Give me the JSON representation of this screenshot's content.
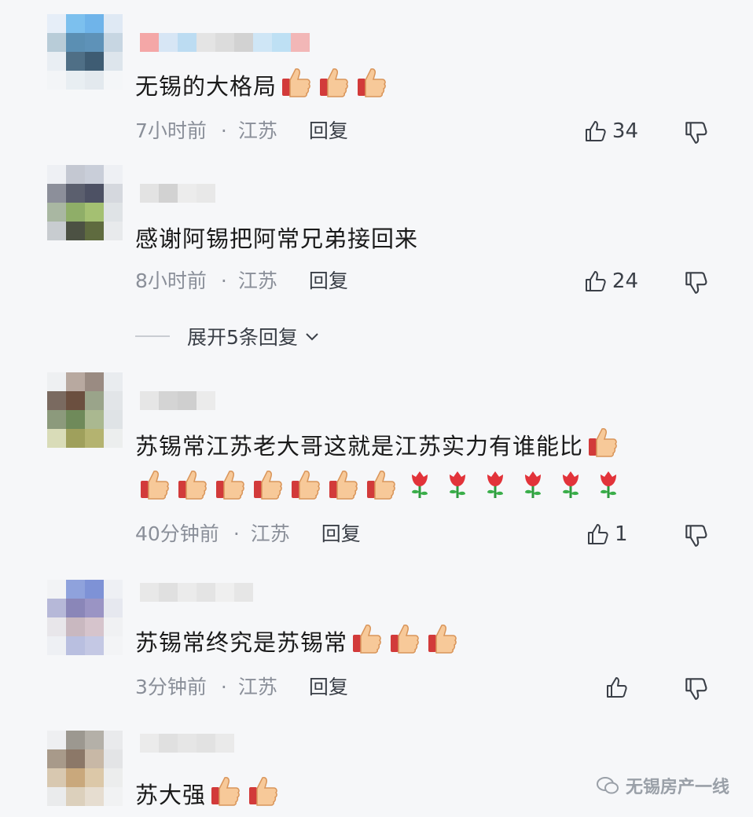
{
  "comments": [
    {
      "text": "无锡的大格局",
      "time": "7小时前",
      "location": "江苏",
      "reply_label": "回复",
      "likes": "34",
      "thumbs": 3,
      "avatar": [
        "#e6eef8",
        "#7cc0ee",
        "#6fb4ea",
        "#dfe9f4",
        "#b8ccd8",
        "#5b8fb3",
        "#5e92b8",
        "#c7d6e2",
        "#e9eef3",
        "#4f6f86",
        "#3e5c73",
        "#dde5ec",
        "#f3f5f7",
        "#e8eef2",
        "#e3e9ee",
        "#f4f6f8"
      ],
      "name_colors": [
        "#f4a7a7",
        "#d7e6f5",
        "#bcdcf2",
        "#e4e4e4",
        "#dcdcdc",
        "#d2d2d2",
        "#cfe6f6",
        "#bee0f4",
        "#f2b7b7"
      ]
    },
    {
      "text": "感谢阿锡把阿常兄弟接回来",
      "time": "8小时前",
      "location": "江苏",
      "reply_label": "回复",
      "likes": "24",
      "thumbs": 0,
      "avatar": [
        "#eef0f4",
        "#c4c8d2",
        "#c9ced9",
        "#eef0f4",
        "#8c8f9a",
        "#5b5f6e",
        "#4d5164",
        "#d5d8de",
        "#a9b7a2",
        "#8fae68",
        "#a4c072",
        "#dfe3e6",
        "#c8ccd0",
        "#4c5143",
        "#5f6b3f",
        "#e8eaec"
      ],
      "name_colors": [
        "#e3e3e3",
        "#d2d2d2",
        "#ececec",
        "#e8e8e8"
      ]
    },
    {
      "text": "苏锡常江苏老大哥这就是江苏实力有谁能比",
      "time": "40分钟前",
      "location": "江苏",
      "reply_label": "回复",
      "likes": "1",
      "thumbs": 8,
      "roses": 6,
      "avatar": [
        "#eef0f2",
        "#b8a9a0",
        "#9a8b82",
        "#e9ecef",
        "#7a6a60",
        "#6b4f3f",
        "#9aa48a",
        "#e2e5e8",
        "#8c9a7c",
        "#6f8a5a",
        "#aab890",
        "#dfe3e6",
        "#d9dcb8",
        "#9fa05c",
        "#b4b370",
        "#eceeee"
      ],
      "name_colors": [
        "#e6e6e6",
        "#d4d4d4",
        "#cfcfcf",
        "#ebebeb"
      ]
    },
    {
      "text": "苏锡常终究是苏锡常",
      "time": "3分钟前",
      "location": "江苏",
      "reply_label": "回复",
      "likes": "",
      "thumbs": 3,
      "avatar": [
        "#f2f3f5",
        "#8fa2dc",
        "#7e92d6",
        "#eef0f4",
        "#b6b8d8",
        "#8a86b8",
        "#9a94c4",
        "#e6e8ef",
        "#e8e6ea",
        "#c9b8c0",
        "#d6c4cc",
        "#f0f1f3",
        "#eef0f4",
        "#b9bfe0",
        "#c4c8e4",
        "#f3f4f6"
      ],
      "name_colors": [
        "#e8e8e8",
        "#e0e0e0",
        "#ebebeb",
        "#e4e4e4",
        "#efefef",
        "#e6e6e6"
      ]
    },
    {
      "text": "苏大强",
      "thumbs": 2,
      "avatar": [
        "#eeeff1",
        "#9c9890",
        "#b4b0a8",
        "#e9eaec",
        "#a89a8a",
        "#8c7868",
        "#c8b8a6",
        "#e3e4e6",
        "#d8c8b0",
        "#c9a87c",
        "#dcc8a8",
        "#eceded",
        "#eaebec",
        "#dcd0bc",
        "#e6ddd0",
        "#f1f2f3"
      ],
      "name_colors": [
        "#ebebeb",
        "#e0e0e0",
        "#e6e6e6",
        "#e2e2e2",
        "#eaeaea"
      ]
    }
  ],
  "expand_label": "展开5条回复",
  "watermark": "无锡房产一线"
}
